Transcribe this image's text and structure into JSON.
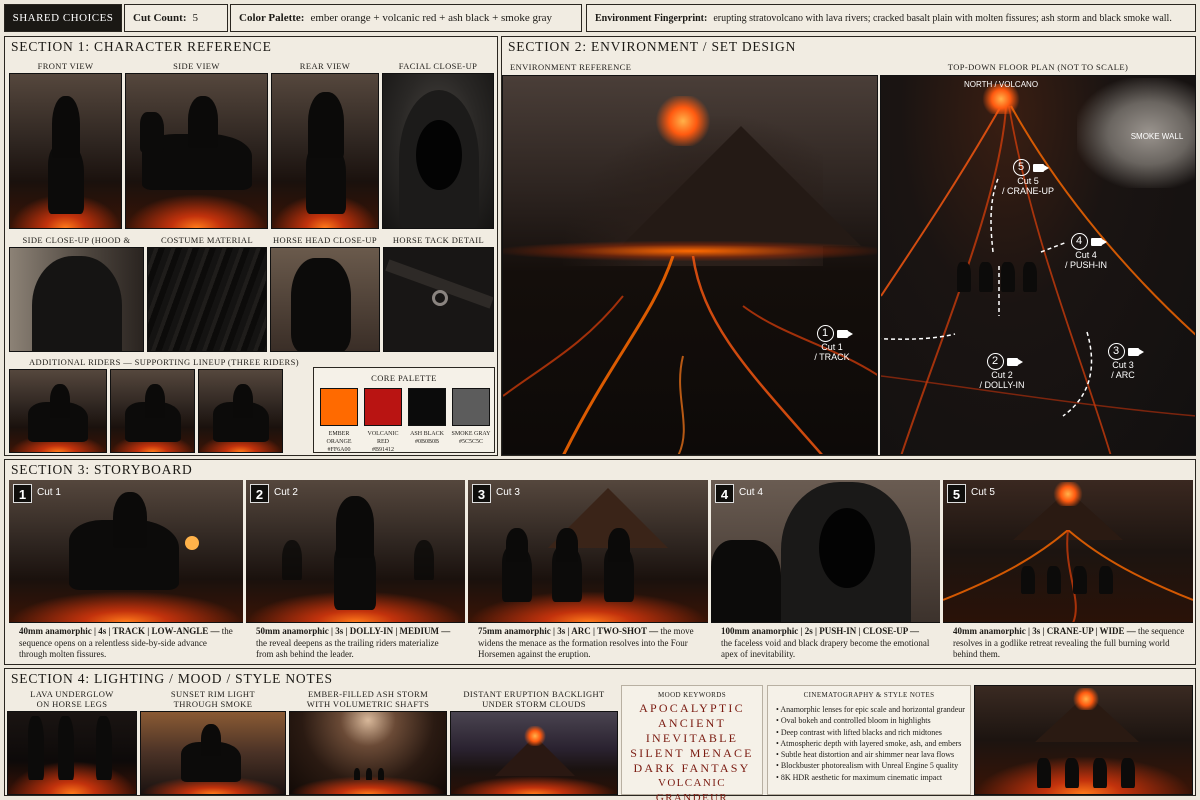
{
  "header": {
    "badge": "SHARED CHOICES",
    "cut_count_label": "Cut Count:",
    "cut_count_value": "5",
    "palette_label": "Color Palette:",
    "palette_value": "ember orange + volcanic red + ash black + smoke gray",
    "env_label": "Environment Fingerprint:",
    "env_value": "erupting stratovolcano with lava rivers; cracked basalt plain with molten fissures; ash storm and black smoke wall."
  },
  "section1": {
    "title": "SECTION 1: CHARACTER REFERENCE",
    "views": [
      "FRONT VIEW",
      "SIDE VIEW",
      "REAR VIEW",
      "FACIAL CLOSE-UP"
    ],
    "details": [
      "SIDE CLOSE-UP (HOOD & DRAPERY)",
      "COSTUME MATERIAL DETAIL",
      "HORSE HEAD CLOSE-UP",
      "HORSE TACK DETAIL"
    ],
    "riders_title": "ADDITIONAL RIDERS — SUPPORTING LINEUP (THREE RIDERS)",
    "palette_title": "CORE PALETTE",
    "palette": [
      {
        "name": "EMBER ORANGE",
        "hex": "#FF6A00",
        "color": "#ff6a00"
      },
      {
        "name": "VOLCANIC RED",
        "hex": "#B91412",
        "color": "#b91412"
      },
      {
        "name": "ASH BLACK",
        "hex": "#0B0B0B",
        "color": "#0b0b0b"
      },
      {
        "name": "SMOKE GRAY",
        "hex": "#5C5C5C",
        "color": "#5c5c5c"
      }
    ]
  },
  "section2": {
    "title": "SECTION 2: ENVIRONMENT / SET DESIGN",
    "env_ref": "ENVIRONMENT REFERENCE",
    "floor_plan": "TOP-DOWN FLOOR PLAN (NOT TO SCALE)",
    "north": "NORTH / VOLCANO",
    "smoke_wall": "SMOKE WALL",
    "cuts": [
      {
        "num": "1",
        "label": "Cut 1",
        "move": "/ TRACK"
      },
      {
        "num": "2",
        "label": "Cut 2",
        "move": "/ DOLLY-IN"
      },
      {
        "num": "3",
        "label": "Cut 3",
        "move": "/ ARC"
      },
      {
        "num": "4",
        "label": "Cut 4",
        "move": "/ PUSH-IN"
      },
      {
        "num": "5",
        "label": "Cut 5",
        "move": "/ CRANE-UP"
      }
    ]
  },
  "section3": {
    "title": "SECTION 3: STORYBOARD",
    "frames": [
      {
        "num": "1",
        "cut": "Cut 1",
        "specs": "40mm anamorphic | 4s | TRACK | LOW-ANGLE —",
        "desc": "the sequence opens on a relentless side-by-side advance through molten fissures."
      },
      {
        "num": "2",
        "cut": "Cut 2",
        "specs": "50mm anamorphic | 3s | DOLLY-IN | MEDIUM —",
        "desc": "the reveal deepens as the trailing riders materialize from ash behind the leader."
      },
      {
        "num": "3",
        "cut": "Cut 3",
        "specs": "75mm anamorphic | 3s | ARC | TWO-SHOT —",
        "desc": "the move widens the menace as the formation resolves into the Four Horsemen against the eruption."
      },
      {
        "num": "4",
        "cut": "Cut 4",
        "specs": "100mm anamorphic | 2s | PUSH-IN | CLOSE-UP —",
        "desc": "the faceless void and black drapery become the emotional apex of inevitability."
      },
      {
        "num": "5",
        "cut": "Cut 5",
        "specs": "40mm anamorphic | 3s | CRANE-UP | WIDE —",
        "desc": "the sequence resolves in a godlike retreat revealing the full burning world behind them."
      }
    ]
  },
  "section4": {
    "title": "SECTION 4: LIGHTING / MOOD / STYLE NOTES",
    "lighting": [
      [
        "LAVA UNDERGLOW",
        "ON HORSE LEGS"
      ],
      [
        "SUNSET RIM LIGHT",
        "THROUGH SMOKE"
      ],
      [
        "EMBER-FILLED ASH STORM",
        "WITH VOLUMETRIC SHAFTS"
      ],
      [
        "DISTANT ERUPTION BACKLIGHT",
        "UNDER STORM CLOUDS"
      ]
    ],
    "mood_title": "MOOD KEYWORDS",
    "mood": [
      "APOCALYPTIC",
      "ANCIENT",
      "INEVITABLE",
      "SILENT MENACE",
      "DARK FANTASY",
      "VOLCANIC GRANDEUR"
    ],
    "notes_title": "CINEMATOGRAPHY & STYLE NOTES",
    "notes": [
      "Anamorphic lenses for epic scale and horizontal grandeur",
      "Oval bokeh and controlled bloom in highlights",
      "Deep contrast with lifted blacks and rich midtones",
      "Atmospheric depth with layered smoke, ash, and embers",
      "Subtle heat distortion and air shimmer near lava flows",
      "Blockbuster photorealism with Unreal Engine 5 quality",
      "8K HDR aesthetic for maximum cinematic impact"
    ]
  }
}
